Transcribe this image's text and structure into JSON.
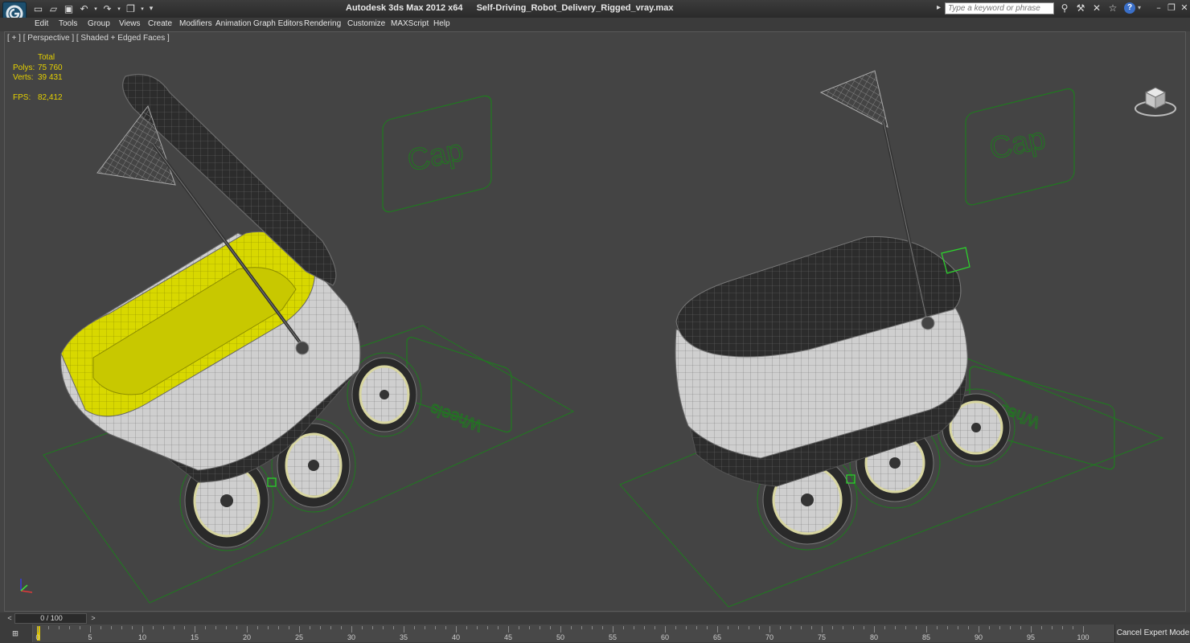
{
  "app": {
    "title": "Autodesk 3ds Max  2012 x64",
    "filename": "Self-Driving_Robot_Delivery_Rigged_vray.max"
  },
  "quick_access": {
    "icons": [
      "new-file-icon",
      "open-file-icon",
      "save-icon",
      "undo-icon",
      "undo-dropdown-icon",
      "redo-icon",
      "redo-dropdown-icon",
      "project-folder-icon",
      "project-dropdown-icon",
      "customize-toolbar-icon"
    ]
  },
  "search": {
    "placeholder": "Type a keyword or phrase"
  },
  "menu": {
    "items": [
      "Edit",
      "Tools",
      "Group",
      "Views",
      "Create",
      "Modifiers",
      "Animation",
      "Graph Editors",
      "Rendering",
      "Customize",
      "MAXScript",
      "Help"
    ]
  },
  "viewport": {
    "label": "[ + ] [ Perspective ] [ Shaded + Edged Faces ]",
    "stats": {
      "header": "Total",
      "polys_label": "Polys:",
      "polys_value": "75 760",
      "verts_label": "Verts:",
      "verts_value": "39 431",
      "fps_label": "FPS:",
      "fps_value": "82,412"
    },
    "scene_text": {
      "cap_label": "Cap",
      "wheels_label": "Wheels"
    }
  },
  "time_slider": {
    "prev_label": "<",
    "position_text": "0 / 100",
    "next_label": ">"
  },
  "trackbar": {
    "ticks": [
      "0",
      "5",
      "10",
      "15",
      "20",
      "25",
      "30",
      "35",
      "40",
      "45",
      "50",
      "55",
      "60",
      "65",
      "70",
      "75",
      "80",
      "85",
      "90",
      "95",
      "100"
    ]
  },
  "status": {
    "expert_button": "Cancel Expert Mode"
  },
  "colors": {
    "viewport_bg": "#444444",
    "selection_yellow": "#e6e600",
    "helper_green": "#1e7a1e",
    "ui_dark": "#3b3b3b"
  }
}
